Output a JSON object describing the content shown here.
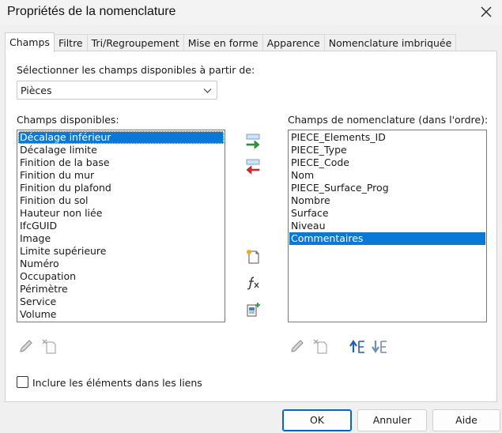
{
  "window": {
    "title": "Propriétés de la nomenclature"
  },
  "tabs": [
    {
      "label": "Champs"
    },
    {
      "label": "Filtre"
    },
    {
      "label": "Tri/Regroupement"
    },
    {
      "label": "Mise en forme"
    },
    {
      "label": "Apparence"
    },
    {
      "label": "Nomenclature imbriquée"
    }
  ],
  "source": {
    "label": "Sélectionner les champs disponibles à partir de:",
    "selected": "Pièces"
  },
  "available": {
    "label": "Champs disponibles:",
    "items": [
      "Décalage inférieur",
      "Décalage limite",
      "Finition de la base",
      "Finition du mur",
      "Finition du plafond",
      "Finition du sol",
      "Hauteur non liée",
      "IfcGUID",
      "Image",
      "Limite supérieure",
      "Numéro",
      "Occupation",
      "Périmètre",
      "Service",
      "Volume"
    ],
    "selected_index": 0
  },
  "schedule": {
    "label": "Champs de nomenclature (dans l'ordre):",
    "items": [
      "PIECE_Elements_ID",
      "PIECE_Type",
      "PIECE_Code",
      "Nom",
      "PIECE_Surface_Prog",
      "Nombre",
      "Surface",
      "Niveau",
      "Commentaires"
    ],
    "selected_index": 8
  },
  "options": {
    "include_links_label": "Inclure les éléments dans les liens",
    "include_links_checked": false
  },
  "buttons": {
    "ok": "OK",
    "cancel": "Annuler",
    "help": "Aide"
  },
  "icons": {
    "add": "arrow-right-green-icon",
    "remove": "arrow-left-red-icon",
    "new_param": "new-parameter-icon",
    "formula": "fx-icon",
    "combine": "combine-parameters-icon",
    "edit": "pencil-icon",
    "delete": "delete-parameter-icon",
    "move_up": "move-up-icon",
    "move_down": "move-down-icon"
  },
  "colors": {
    "selection": "#0a78d7",
    "primary_border": "#0a64c8"
  }
}
